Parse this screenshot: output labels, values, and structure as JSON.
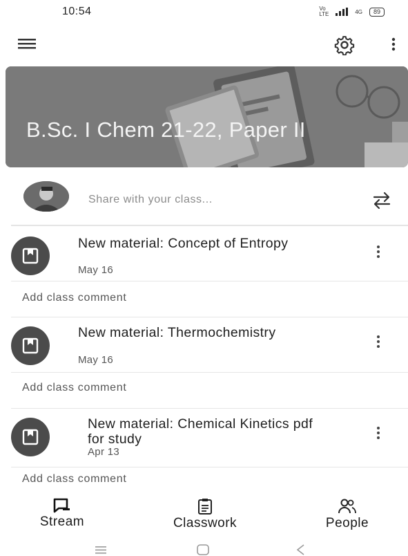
{
  "status": {
    "time": "10:54",
    "network": "Vo LTE",
    "data": "4G",
    "battery": "89"
  },
  "class": {
    "title": "B.Sc. I Chem 21-22, Paper II"
  },
  "share": {
    "placeholder": "Share with your class..."
  },
  "posts": [
    {
      "title": "New material: Concept of Entropy",
      "date": "May 16",
      "comment": "Add class comment"
    },
    {
      "title": "New material: Thermochemistry",
      "date": "May 16",
      "comment": "Add class comment"
    },
    {
      "title": "New material: Chemical Kinetics pdf for study",
      "date": "Apr 13",
      "comment": "Add class comment"
    }
  ],
  "nav": {
    "stream": "Stream",
    "classwork": "Classwork",
    "people": "People"
  },
  "icons": [
    "menu-icon",
    "gear-icon",
    "more-vert-icon",
    "swap-icon",
    "material-icon",
    "stream-icon",
    "classwork-icon",
    "people-icon"
  ],
  "colors": {
    "banner": "#7a7a7a",
    "icon_bg": "#4b4b4b",
    "text": "#1e1e1e"
  }
}
